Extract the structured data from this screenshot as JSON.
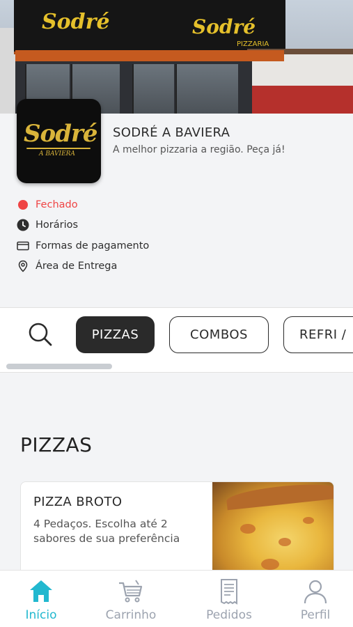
{
  "store": {
    "name": "SODRÉ A BAVIERA",
    "description": "A melhor pizzaria a região. Peça já!",
    "logo_text": "Sodré",
    "logo_sub": "A BAVIERA",
    "banner_sign": "Sodré",
    "banner_sign_small": "PIZZARIA"
  },
  "info": {
    "status": "Fechado",
    "hours": "Horários",
    "payment": "Formas de pagamento",
    "delivery": "Área de Entrega"
  },
  "categories": [
    {
      "label": "PIZZAS",
      "active": true
    },
    {
      "label": "COMBOS",
      "active": false
    },
    {
      "label": "REFRI /",
      "active": false
    }
  ],
  "section": {
    "title": "PIZZAS"
  },
  "products": [
    {
      "name": "PIZZA BROTO",
      "description": "4 Pedaços. Escolha até 2 sabores de sua preferência"
    }
  ],
  "nav": [
    {
      "label": "Início",
      "icon": "home-icon",
      "active": true
    },
    {
      "label": "Carrinho",
      "icon": "cart-icon",
      "active": false
    },
    {
      "label": "Pedidos",
      "icon": "receipt-icon",
      "active": false
    },
    {
      "label": "Perfil",
      "icon": "user-icon",
      "active": false
    }
  ],
  "colors": {
    "accent": "#22b8cf",
    "status_closed": "#ef4444",
    "chip_active": "#2a2a2a"
  }
}
